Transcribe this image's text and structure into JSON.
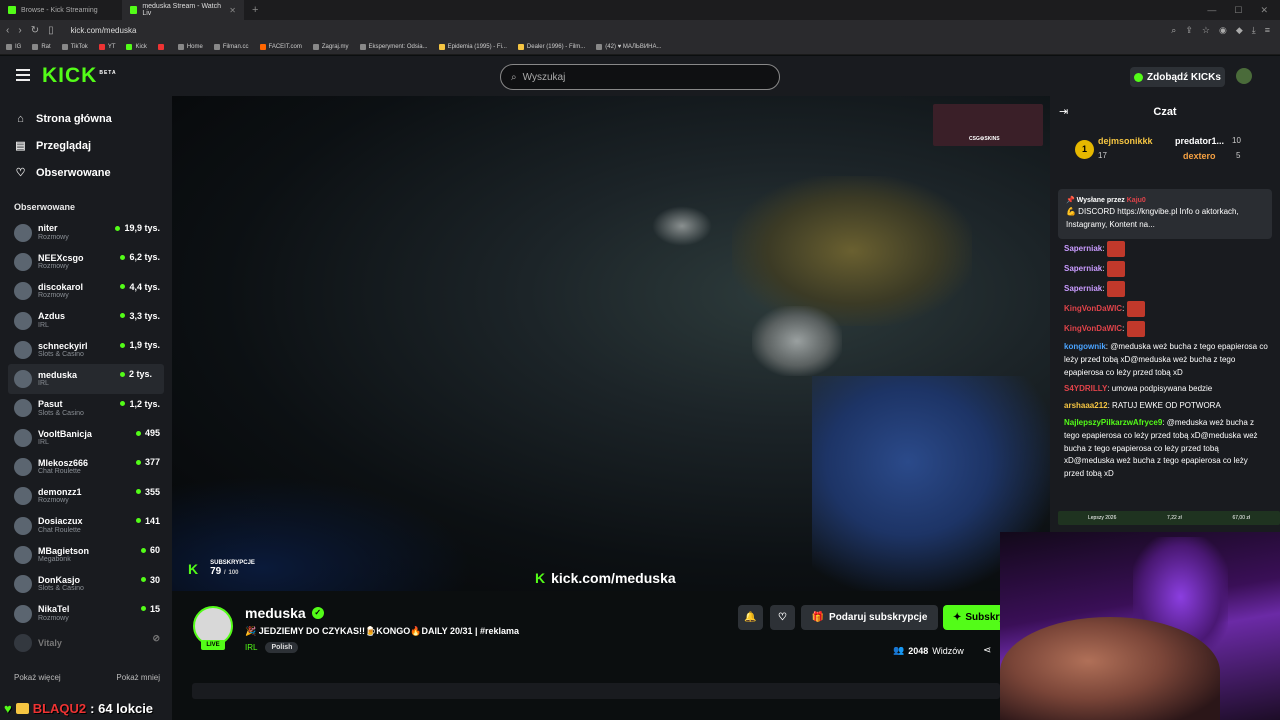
{
  "browser": {
    "tabs": [
      {
        "label": "Browse - Kick Streaming",
        "active": false
      },
      {
        "label": "meduska Stream - Watch Liv",
        "active": true
      }
    ],
    "url": "kick.com/meduska",
    "bookmarks": [
      "IG",
      "Rat",
      "TikTok",
      "YT",
      "Kick",
      "",
      "Home",
      "Filman.cc",
      "FACEIT.com",
      "Zagraj.my",
      "Eksperyment: Odsia...",
      "Epidemia (1995) - Fi...",
      "Dealer (1996) - Film...",
      "(42) ♥ МАЛЬВИНА..."
    ]
  },
  "header": {
    "logo": "KICK",
    "logo_badge": "BETA",
    "search_placeholder": "Wyszukaj",
    "get_kicks": "Zdobądź KICKs"
  },
  "sidebar": {
    "nav": [
      {
        "label": "Strona główna",
        "icon": "home-icon"
      },
      {
        "label": "Przeglądaj",
        "icon": "browse-icon"
      },
      {
        "label": "Obserwowane",
        "icon": "heart-icon"
      }
    ],
    "followed_title": "Obserwowane",
    "channels": [
      {
        "name": "niter",
        "category": "Rozmowy",
        "viewers": "19,9 tys."
      },
      {
        "name": "NEEXcsgo",
        "category": "Rozmowy",
        "viewers": "6,2 tys."
      },
      {
        "name": "discokarol",
        "category": "Rozmowy",
        "viewers": "4,4 tys."
      },
      {
        "name": "Azdus",
        "category": "IRL",
        "viewers": "3,3 tys."
      },
      {
        "name": "schneckyirl",
        "category": "Slots & Casino",
        "viewers": "1,9 tys."
      },
      {
        "name": "meduska",
        "category": "IRL",
        "viewers": "2 tys."
      },
      {
        "name": "Pasut",
        "category": "Slots & Casino",
        "viewers": "1,2 tys."
      },
      {
        "name": "VooltBanicja",
        "category": "IRL",
        "viewers": "495"
      },
      {
        "name": "Mlekosz666",
        "category": "Chat Roulette",
        "viewers": "377"
      },
      {
        "name": "demonzz1",
        "category": "Rozmowy",
        "viewers": "355"
      },
      {
        "name": "Dosiaczux",
        "category": "Chat Roulette",
        "viewers": "141"
      },
      {
        "name": "MBagietson",
        "category": "Megabonk",
        "viewers": "60"
      },
      {
        "name": "DonKasjo",
        "category": "Slots & Casino",
        "viewers": "30"
      },
      {
        "name": "NikaTel",
        "category": "Rozmowy",
        "viewers": "15"
      }
    ],
    "offline_channel": "Vitaly",
    "show_more": "Pokaż więcej",
    "show_less": "Pokaż mniej"
  },
  "video": {
    "ad_label": "CSG⚙SKINS",
    "sub_goal_label": "SUBSKRYPCJE",
    "sub_goal_current": "79",
    "sub_goal_target": "100",
    "sub_goal_separator": "/",
    "watermark": "kick.com/meduska"
  },
  "stream": {
    "name": "meduska",
    "live": "LIVE",
    "title": "🎉 JEDZIEMY DO CZYKAS!!🍺KONGO🔥DAILY 20/31 | #reklama",
    "category": "IRL",
    "language": "Polish",
    "gift_label": "Podaruj subskrypcje",
    "subscribe_label": "Subskrybuj",
    "viewers": "2048",
    "viewers_label": "Widzów"
  },
  "chat": {
    "title": "Czat",
    "leaderboard": [
      {
        "rank": "1",
        "name": "dejmsonikkk",
        "value": "17"
      },
      {
        "name": "predator1...",
        "value": "10"
      },
      {
        "name": "dextero",
        "value": "5"
      }
    ],
    "pinned_by_label": "Wysłane przez",
    "pinned_by_user": "Kaju0",
    "pinned_text": "💪 DISCORD https://kngvibe.pl Info o aktorkach, Instagramy, Kontent na...",
    "messages": [
      {
        "user": "Saperniak",
        "text": "",
        "color": "#c99bff",
        "emote": true
      },
      {
        "user": "Saperniak",
        "text": "",
        "color": "#c99bff",
        "emote": true
      },
      {
        "user": "Saperniak",
        "text": "",
        "color": "#c99bff",
        "emote": true
      },
      {
        "user": "KingVonDaWIC",
        "text": "",
        "color": "#e0434a",
        "emote": true
      },
      {
        "user": "KingVonDaWIC",
        "text": "",
        "color": "#e0434a",
        "emote": true
      },
      {
        "user": "kongownik",
        "text": "@meduska weż bucha z tego epapierosa co leży przed tobą xD@meduska weż bucha z tego epapierosa co leży przed tobą xD",
        "color": "#4aa3ff",
        "emote": false
      },
      {
        "user": "S4YDRILLY",
        "text": "umowa podpisywana bedzie",
        "color": "#e0434a",
        "emote": false
      },
      {
        "user": "arshaaa212",
        "text": "RATUJ EWKE OD POTWORA",
        "color": "#f5c542",
        "emote": false
      },
      {
        "user": "NajlepszyPilkarzwAfryce9",
        "text": "@meduska weż bucha z tego epapierosa co leży przed tobą xD@meduska weż bucha z tego epapierosa co leży przed tobą xD@meduska weż bucha z tego epapierosa co leży przed tobą xD",
        "color": "#53fc18",
        "emote": false
      }
    ],
    "bet_label": "Lepszy 2026",
    "bet_value_a": "7,22 zł",
    "bet_value_b": "67,00 zł"
  },
  "overlay": {
    "user": "BLAQU2",
    "text": ": 64 lokcie"
  }
}
